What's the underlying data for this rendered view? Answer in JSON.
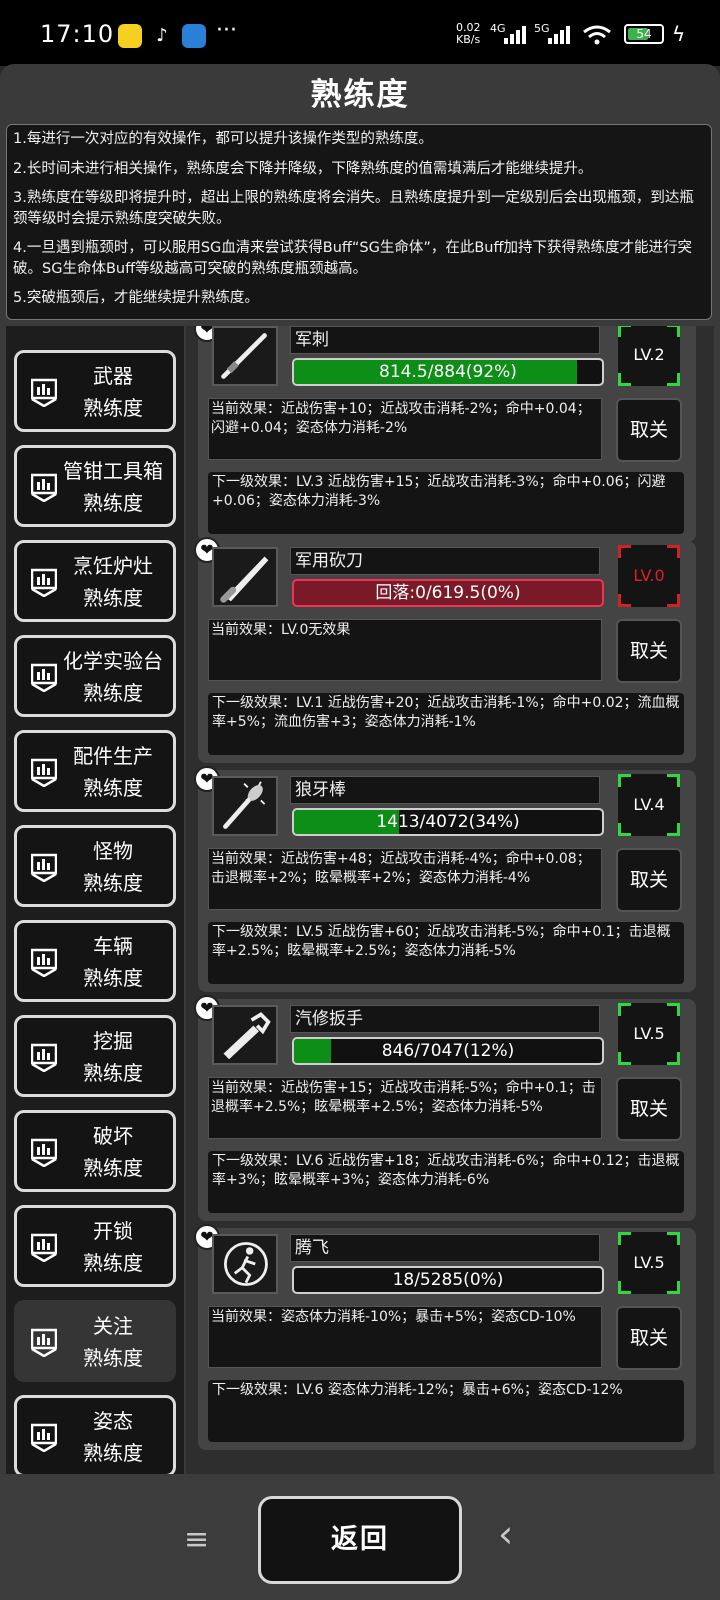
{
  "status": {
    "time": "17:10",
    "net_speed_top": "0.02",
    "net_speed_bottom": "KB/s",
    "sig1": "4G",
    "sig2": "5G",
    "wifi_num": "6",
    "battery": "54",
    "more": "···"
  },
  "title": "熟练度",
  "rules": [
    "1.每进行一次对应的有效操作，都可以提升该操作类型的熟练度。",
    "2.长时间未进行相关操作，熟练度会下降并降级，下降熟练度的值需填满后才能继续提升。",
    "3.熟练度在等级即将提升时，超出上限的熟练度将会消失。且熟练度提升到一定级别后会出现瓶颈，到达瓶颈等级时会提示熟练度突破失败。",
    "4.一旦遇到瓶颈时，可以服用SG血清来尝试获得Buff“SG生命体”，在此Buff加持下获得熟练度才能进行突破。SG生命体Buff等级越高可突破的熟练度瓶颈越高。",
    "5.突破瓶颈后，才能继续提升熟练度。"
  ],
  "nav": [
    {
      "l1": "武器",
      "l2": "熟练度",
      "active": false
    },
    {
      "l1": "管钳工具箱",
      "l2": "熟练度",
      "active": false
    },
    {
      "l1": "烹饪炉灶",
      "l2": "熟练度",
      "active": false
    },
    {
      "l1": "化学实验台",
      "l2": "熟练度",
      "active": false
    },
    {
      "l1": "配件生产",
      "l2": "熟练度",
      "active": false
    },
    {
      "l1": "怪物",
      "l2": "熟练度",
      "active": false
    },
    {
      "l1": "车辆",
      "l2": "熟练度",
      "active": false
    },
    {
      "l1": "挖掘",
      "l2": "熟练度",
      "active": false
    },
    {
      "l1": "破坏",
      "l2": "熟练度",
      "active": false
    },
    {
      "l1": "开锁",
      "l2": "熟练度",
      "active": false
    },
    {
      "l1": "关注",
      "l2": "熟练度",
      "active": true
    },
    {
      "l1": "姿态",
      "l2": "熟练度",
      "active": false
    }
  ],
  "cards": [
    {
      "name": "军刺",
      "progress_text": "814.5/884(92%)",
      "progress": 0.92,
      "negative": false,
      "level": "LV.2",
      "current": "当前效果：近战伤害+10；近战攻击消耗-2%；命中+0.04；闪避+0.04；姿态体力消耗-2%",
      "next": "下一级效果：LV.3 近战伤害+15；近战攻击消耗-3%；命中+0.06；闪避+0.06；姿态体力消耗-3%",
      "cancel": "取关",
      "icon": "bayonet-icon"
    },
    {
      "name": "军用砍刀",
      "progress_text": "回落:0/619.5(0%)",
      "progress": 0,
      "negative": true,
      "level": "LV.0",
      "current": "当前效果：LV.0无效果",
      "next": "下一级效果：LV.1 近战伤害+20；近战攻击消耗-1%；命中+0.02；流血概率+5%；流血伤害+3；姿态体力消耗-1%",
      "cancel": "取关",
      "icon": "machete-icon"
    },
    {
      "name": "狼牙棒",
      "progress_text": "1413/4072(34%)",
      "progress": 0.34,
      "negative": false,
      "level": "LV.4",
      "current": "当前效果：近战伤害+48；近战攻击消耗-4%；命中+0.08；击退概率+2%；眩晕概率+2%；姿态体力消耗-4%",
      "next": "下一级效果：LV.5 近战伤害+60；近战攻击消耗-5%；命中+0.1；击退概率+2.5%；眩晕概率+2.5%；姿态体力消耗-5%",
      "cancel": "取关",
      "icon": "spiked-club-icon"
    },
    {
      "name": "汽修扳手",
      "progress_text": "846/7047(12%)",
      "progress": 0.12,
      "negative": false,
      "level": "LV.5",
      "current": "当前效果：近战伤害+15；近战攻击消耗-5%；命中+0.1；击退概率+2.5%；眩晕概率+2.5%；姿态体力消耗-5%",
      "next": "下一级效果：LV.6 近战伤害+18；近战攻击消耗-6%；命中+0.12；击退概率+3%；眩晕概率+3%；姿态体力消耗-6%",
      "cancel": "取关",
      "icon": "wrench-icon"
    },
    {
      "name": "腾飞",
      "progress_text": "18/5285(0%)",
      "progress": 0,
      "negative": false,
      "level": "LV.5",
      "current": "当前效果：姿态体力消耗-10%；暴击+5%；姿态CD-10%",
      "next": "下一级效果：LV.6 姿态体力消耗-12%；暴击+6%；姿态CD-12%",
      "cancel": "取关",
      "icon": "leaping-figure-icon"
    }
  ],
  "back": "返回",
  "sysnav": {
    "menu": "≡",
    "home": "▢",
    "back": "‹"
  }
}
